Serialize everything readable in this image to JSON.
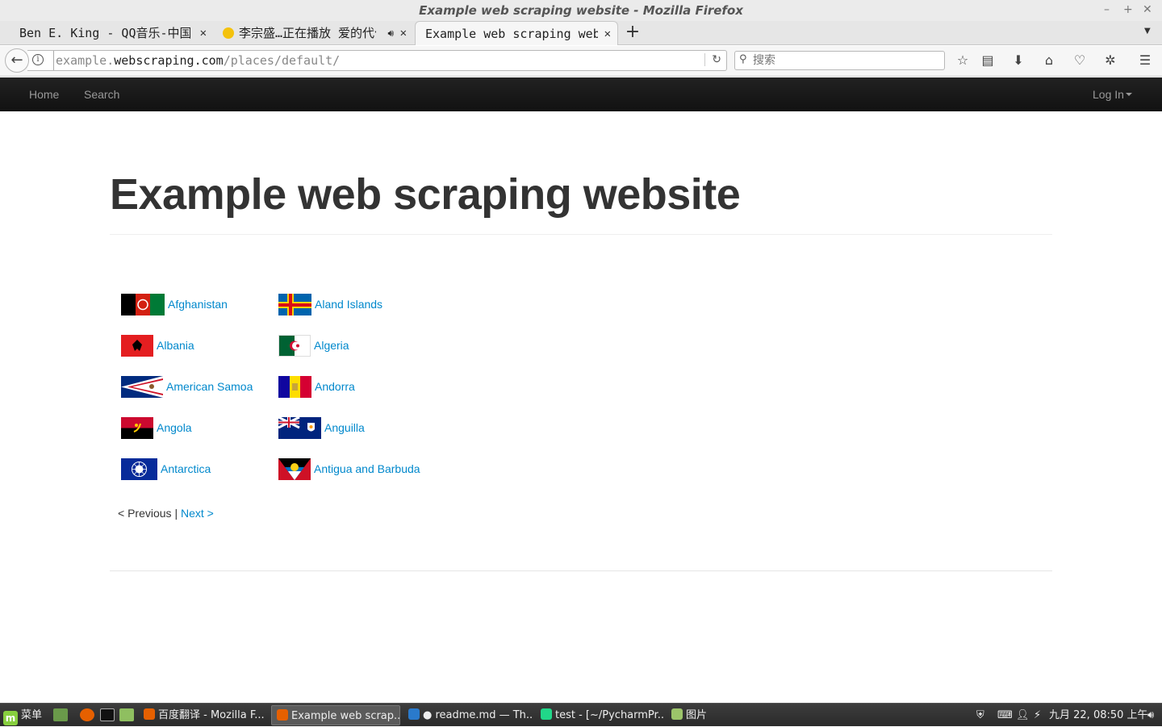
{
  "browser": {
    "window_title": "Example web scraping website - Mozilla Firefox",
    "tabs": [
      {
        "label": "Ben E. King - QQ音乐-中国"
      },
      {
        "label": "李宗盛…正在播放 爱的代价"
      },
      {
        "label": "Example web scraping website"
      }
    ],
    "url": {
      "subdomain": "example.",
      "domain": "webscraping.com",
      "path": "/places/default/"
    },
    "search_placeholder": "搜索"
  },
  "site": {
    "nav": {
      "home": "Home",
      "search": "Search",
      "login": "Log In"
    },
    "title": "Example web scraping website",
    "countries": [
      {
        "name": "Afghanistan",
        "flag": "af"
      },
      {
        "name": "Aland Islands",
        "flag": "ax"
      },
      {
        "name": "Albania",
        "flag": "al"
      },
      {
        "name": "Algeria",
        "flag": "dz"
      },
      {
        "name": "American Samoa",
        "flag": "as"
      },
      {
        "name": "Andorra",
        "flag": "ad"
      },
      {
        "name": "Angola",
        "flag": "ao"
      },
      {
        "name": "Anguilla",
        "flag": "ai"
      },
      {
        "name": "Antarctica",
        "flag": "aq"
      },
      {
        "name": "Antigua and Barbuda",
        "flag": "ag"
      }
    ],
    "pager": {
      "previous": "< Previous",
      "separator": "|",
      "next": "Next >"
    },
    "colors": {
      "link": "#0088cc",
      "navbar": "#1b1b1b",
      "title": "#333333"
    }
  },
  "taskbar": {
    "menu_label": "菜单",
    "tasks": [
      {
        "label": "百度翻译 - Mozilla F..."
      },
      {
        "label": "Example web scrap..."
      },
      {
        "label": "● readme.md — Th..."
      },
      {
        "label": "test - [~/PycharmPr..."
      },
      {
        "label": "图片"
      }
    ],
    "clock": "九月 22, 08:50 上午"
  }
}
